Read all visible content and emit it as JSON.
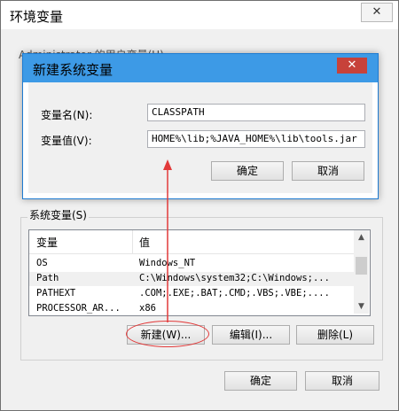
{
  "main_window": {
    "title": "环境变量",
    "close_glyph": "✕",
    "user_vars_label": "Administrator 的用户变量(U)"
  },
  "system_vars": {
    "group_label": "系统变量(S)",
    "columns": {
      "name": "变量",
      "value": "值"
    },
    "rows": [
      {
        "name": "OS",
        "value": "Windows_NT"
      },
      {
        "name": "Path",
        "value": "C:\\Windows\\system32;C:\\Windows;..."
      },
      {
        "name": "PATHEXT",
        "value": ".COM;.EXE;.BAT;.CMD;.VBS;.VBE;...."
      },
      {
        "name": "PROCESSOR_AR...",
        "value": "x86"
      }
    ],
    "scroll_up": "▲",
    "scroll_down": "▼",
    "new_button": "新建(W)...",
    "edit_button": "编辑(I)...",
    "delete_button": "删除(L)"
  },
  "footer": {
    "ok_button": "确定",
    "cancel_button": "取消"
  },
  "new_var_dialog": {
    "title": "新建系统变量",
    "close_glyph": "✕",
    "name_label": "变量名(N):",
    "name_value": "CLASSPATH",
    "value_label": "变量值(V):",
    "value_value": "HOME%\\lib;%JAVA_HOME%\\lib\\tools.jar",
    "ok_button": "确定",
    "cancel_button": "取消"
  },
  "colors": {
    "dialog_title_bg": "#3d9ae6",
    "close_button_red": "#c7423a",
    "annotation_red": "#e23a3a"
  }
}
